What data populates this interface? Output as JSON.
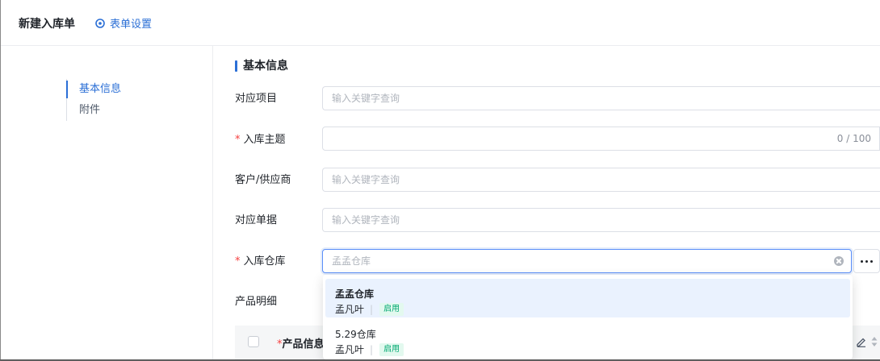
{
  "header": {
    "title": "新建入库单",
    "settings_label": "表单设置",
    "settings_icon": "settings-ring-icon",
    "accent_color": "#2b6fd6"
  },
  "side_nav": {
    "items": [
      {
        "label": "基本信息",
        "active": true
      },
      {
        "label": "附件",
        "active": false
      }
    ]
  },
  "section": {
    "title": "基本信息"
  },
  "form": {
    "project": {
      "label": "对应项目",
      "placeholder": "输入关键字查询",
      "value": ""
    },
    "subject": {
      "required_mark": "*",
      "label": "入库主题",
      "value": "",
      "counter": "0 / 100"
    },
    "customer": {
      "label": "客户/供应商",
      "placeholder": "输入关键字查询",
      "value": ""
    },
    "document": {
      "label": "对应单据",
      "placeholder": "输入关键字查询",
      "value": ""
    },
    "warehouse": {
      "required_mark": "*",
      "label": "入库仓库",
      "placeholder": "孟孟仓库",
      "value": ""
    },
    "product_detail": {
      "label": "产品明细"
    }
  },
  "warehouse_dropdown": {
    "options": [
      {
        "name": "孟孟仓库",
        "owner": "孟凡叶",
        "separator": "|",
        "status": "启用",
        "selected": true
      },
      {
        "name": "5.29仓库",
        "owner": "孟凡叶",
        "separator": "|",
        "status": "启用",
        "selected": false
      }
    ],
    "status_color": "#00a870"
  },
  "product_table": {
    "required_mark": "*",
    "column_product": "产品信息"
  }
}
